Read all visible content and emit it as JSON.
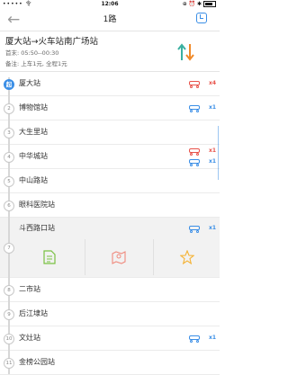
{
  "status_bar": {
    "carrier": "••••• 令",
    "time": "12:06",
    "right": "⊕ ⏰ ✱"
  },
  "nav": {
    "back_glyph": "←",
    "title": "1路"
  },
  "route": {
    "from_to": "厦大站→火车站南广场站",
    "times": "首末: 05:50--00:30",
    "fare": "备注: 上车1元, 全程1元"
  },
  "stops": [
    {
      "index": "起",
      "name": "厦大站",
      "buses": [
        {
          "color": "red",
          "count": "x4"
        }
      ]
    },
    {
      "index": "2",
      "name": "博物馆站",
      "buses": [
        {
          "color": "blue",
          "count": "x1"
        }
      ]
    },
    {
      "index": "3",
      "name": "大生里站",
      "buses": []
    },
    {
      "index": "4",
      "name": "中华城站",
      "buses": [
        {
          "color": "red",
          "count": "x1"
        },
        {
          "color": "blue",
          "count": "x1"
        }
      ]
    },
    {
      "index": "5",
      "name": "中山路站",
      "buses": []
    },
    {
      "index": "6",
      "name": "眼科医院站",
      "buses": []
    },
    {
      "index": "7",
      "name": "斗西路口站",
      "buses": [
        {
          "color": "blue",
          "count": "x1"
        }
      ],
      "expanded": true
    },
    {
      "index": "8",
      "name": "二市站",
      "buses": []
    },
    {
      "index": "9",
      "name": "后江埭站",
      "buses": []
    },
    {
      "index": "10",
      "name": "文灶站",
      "buses": [
        {
          "color": "blue",
          "count": "x1"
        }
      ]
    },
    {
      "index": "11",
      "name": "金榜公园站",
      "buses": []
    }
  ],
  "stop_actions": [
    {
      "icon": "document-icon",
      "color": "#7ac143"
    },
    {
      "icon": "map-pin-icon",
      "color": "#f08a7d"
    },
    {
      "icon": "star-icon",
      "color": "#f5b335"
    }
  ],
  "colors": {
    "accent": "#3a8ee6",
    "bus_red": "#e8524a",
    "bus_blue": "#3a8ee6"
  }
}
